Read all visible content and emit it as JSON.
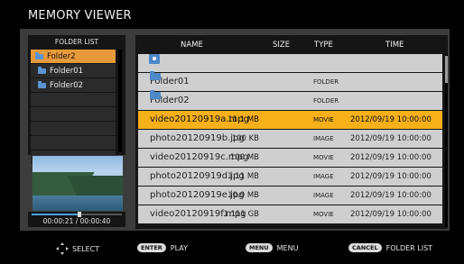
{
  "app": {
    "title": "MEMORY VIEWER"
  },
  "folder_panel": {
    "header": "FOLDER LIST",
    "items": [
      {
        "label": "Folder2",
        "selected": true
      },
      {
        "label": "Folder01",
        "selected": false
      },
      {
        "label": "Folder02",
        "selected": false
      }
    ],
    "empty_rows": 5
  },
  "preview": {
    "time": "00:00:21 / 00:00:40",
    "progress": 0.525
  },
  "table": {
    "headers": {
      "name": "NAME",
      "size": "SIZE",
      "type": "TYPE",
      "time": "TIME"
    },
    "rows": [
      {
        "kind": "up",
        "icon": "folder-up-icon",
        "name": "",
        "size": "",
        "type": "",
        "time": ""
      },
      {
        "kind": "folder",
        "icon": "folder-icon",
        "name": "Folder01",
        "size": "",
        "type": "FOLDER",
        "time": ""
      },
      {
        "kind": "folder",
        "icon": "folder-icon",
        "name": "Folder02",
        "size": "",
        "type": "FOLDER",
        "time": ""
      },
      {
        "kind": "file",
        "name": "video20120919a.mpg",
        "size": "11.1 MB",
        "type": "MOVIE",
        "time": "2012/09/19  10:00:00",
        "selected": true
      },
      {
        "kind": "file",
        "name": "photo20120919b.jpg",
        "size": "100 KB",
        "type": "IMAGE",
        "time": "2012/09/19  10:00:00"
      },
      {
        "kind": "file",
        "name": "video20120919c.mpg",
        "size": "100 MB",
        "type": "MOVIE",
        "time": "2012/09/19  10:00:00"
      },
      {
        "kind": "file",
        "name": "photo20120919d.jpg",
        "size": "1.11 MB",
        "type": "IMAGE",
        "time": "2012/09/19  10:00:00"
      },
      {
        "kind": "file",
        "name": "photo20120919e.jpg",
        "size": "10.0 MB",
        "type": "IMAGE",
        "time": "2012/09/19  10:00:00"
      },
      {
        "kind": "file",
        "name": "video20120919f.mpg",
        "size": "1.111 GB",
        "type": "MOVIE",
        "time": "2012/09/19  10:00:00"
      }
    ]
  },
  "footer": {
    "select_label": "SELECT",
    "play_key": "ENTER",
    "play_label": "PLAY",
    "menu_key": "MENU",
    "menu_label": "MENU",
    "cancel_key": "CANCEL",
    "cancel_label": "FOLDER LIST"
  },
  "colors": {
    "selection": "#f5b01a",
    "folder_selection": "#e79a3b",
    "row_bg": "#cfcfcf",
    "panel_bg": "#3c3c3c",
    "folder_icon": "#4d88c8"
  }
}
